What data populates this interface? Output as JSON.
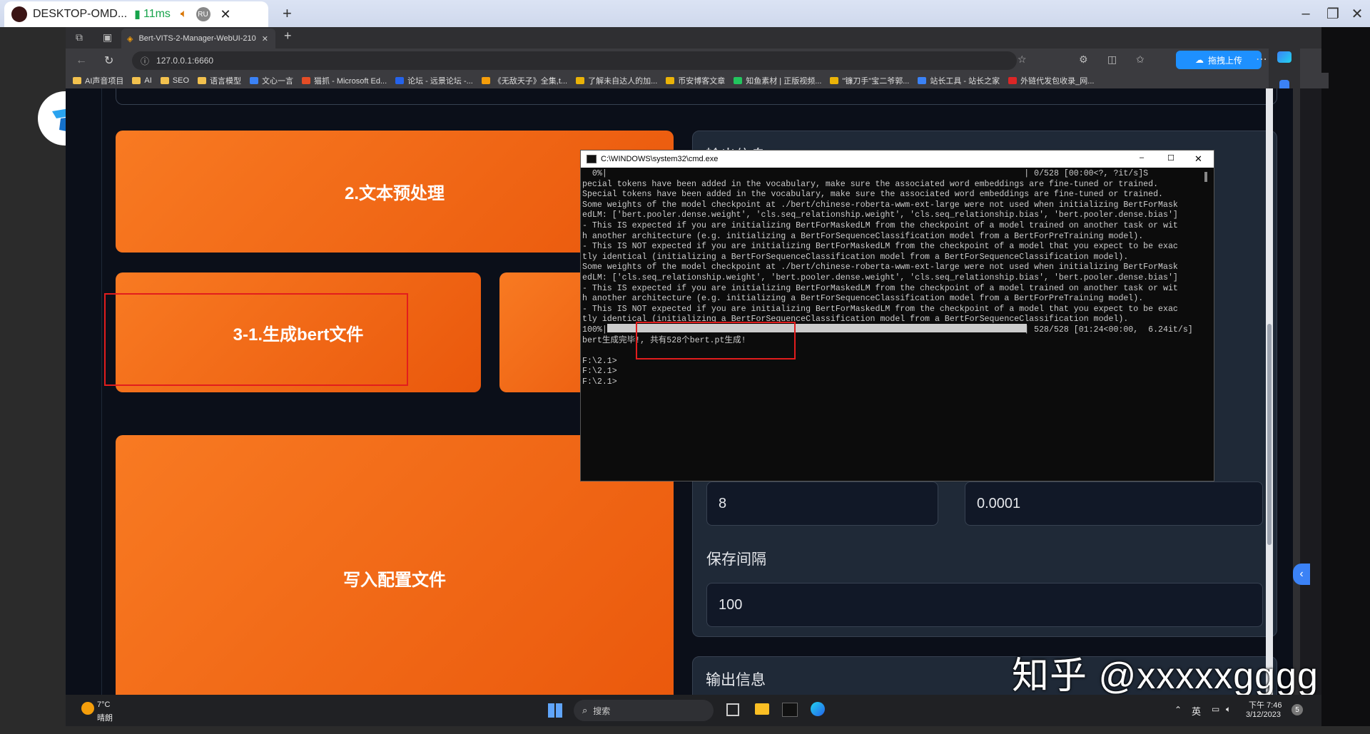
{
  "outer": {
    "tab_title": "DESKTOP-OMD...",
    "ping": "11ms",
    "lang_badge": "RU",
    "close_glyph": "✕",
    "new_tab_glyph": "+"
  },
  "browser": {
    "tab_title": "Bert-VITS-2-Manager-WebUI-210",
    "url": "127.0.0.1:6660",
    "upload_button": "拖拽上传",
    "bookmarks": [
      {
        "label": "AI声音项目",
        "color": "#f2c14e"
      },
      {
        "label": "AI",
        "color": "#f2c14e"
      },
      {
        "label": "SEO",
        "color": "#f2c14e"
      },
      {
        "label": "语言模型",
        "color": "#f2c14e"
      },
      {
        "label": "文心一言",
        "color": "#3b82f6"
      },
      {
        "label": "猫抓 - Microsoft Ed...",
        "color": "#e44d26"
      },
      {
        "label": "论坛 - 远景论坛 -...",
        "color": "#2563eb"
      },
      {
        "label": "《无敌天子》全集,t...",
        "color": "#f59e0b"
      },
      {
        "label": "了解未自达人的加...",
        "color": "#eab308"
      },
      {
        "label": "币安博客文章",
        "color": "#eab308"
      },
      {
        "label": "知鱼素材 | 正版视频...",
        "color": "#22c55e"
      },
      {
        "label": "\"镰刀手\"宝二爷郭...",
        "color": "#eab308"
      },
      {
        "label": "站长工具 - 站长之家",
        "color": "#3b82f6"
      },
      {
        "label": "外链代发包收录_网...",
        "color": "#dc2626"
      }
    ]
  },
  "webui": {
    "card_preprocess": "2.文本预处理",
    "card_bert": "3-1.生成bert文件",
    "card_config": "写入配置文件",
    "output_label_top": "输出信息",
    "field_batch_value": "8",
    "field_lr_value": "0.0001",
    "save_interval_label": "保存间隔",
    "save_interval_value": "100",
    "output_label": "输出信息"
  },
  "cmd": {
    "title": "C:\\WINDOWS\\system32\\cmd.exe",
    "lines": [
      "  0%|                                                                                    | 0/528 [00:00<?, ?it/s]S",
      "pecial tokens have been added in the vocabulary, make sure the associated word embeddings are fine-tuned or trained.",
      "Special tokens have been added in the vocabulary, make sure the associated word embeddings are fine-tuned or trained.",
      "Some weights of the model checkpoint at ./bert/chinese-roberta-wwm-ext-large were not used when initializing BertForMask",
      "edLM: ['bert.pooler.dense.weight', 'cls.seq_relationship.weight', 'cls.seq_relationship.bias', 'bert.pooler.dense.bias']",
      "- This IS expected if you are initializing BertForMaskedLM from the checkpoint of a model trained on another task or wit",
      "h another architecture (e.g. initializing a BertForSequenceClassification model from a BertForPreTraining model).",
      "- This IS NOT expected if you are initializing BertForMaskedLM from the checkpoint of a model that you expect to be exac",
      "tly identical (initializing a BertForSequenceClassification model from a BertForSequenceClassification model).",
      "Some weights of the model checkpoint at ./bert/chinese-roberta-wwm-ext-large were not used when initializing BertForMask",
      "edLM: ['cls.seq_relationship.weight', 'bert.pooler.dense.weight', 'cls.seq_relationship.bias', 'bert.pooler.dense.bias']",
      "- This IS expected if you are initializing BertForMaskedLM from the checkpoint of a model trained on another task or wit",
      "h another architecture (e.g. initializing a BertForSequenceClassification model from a BertForPreTraining model).",
      "- This IS NOT expected if you are initializing BertForMaskedLM from the checkpoint of a model that you expect to be exac",
      "tly identical (initializing a BertForSequenceClassification model from a BertForSequenceClassification model).",
      "100%|                                                                                    | 528/528 [01:24<00:00,  6.24it/s]",
      "bert生成完毕!, 共有528个bert.pt生成!",
      "",
      "F:\\2.1>",
      "F:\\2.1>",
      "F:\\2.1>"
    ]
  },
  "taskbar": {
    "weather_temp": "7°C",
    "weather_desc": "晴朗",
    "search_label": "搜索",
    "ime": "英",
    "time": "下午 7:46",
    "date": "3/12/2023",
    "notif_count": "5"
  },
  "watermark": "知乎 @xxxxxgggg",
  "colors": {
    "card_orange": "#f2711c",
    "page_bg": "#0b0f19",
    "highlight_red": "#e21d1d"
  }
}
